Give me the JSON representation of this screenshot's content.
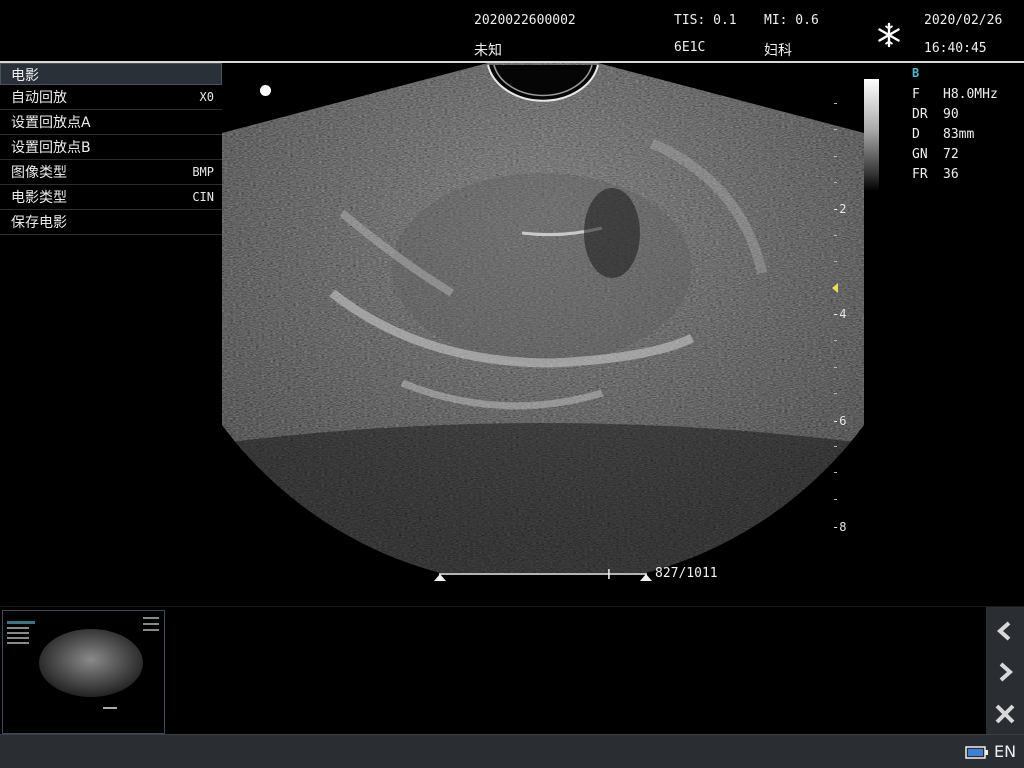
{
  "header": {
    "patient_id": "2020022600002",
    "patient_name": "未知",
    "tis": "TIS: 0.1",
    "mi": "MI: 0.6",
    "probe": "6E1C",
    "exam": "妇科",
    "date": "2020/02/26",
    "time": "16:40:45",
    "freeze_icon": "snowflake-icon"
  },
  "cine_menu": {
    "title": "电影",
    "items": [
      {
        "label": "自动回放",
        "value": "X0"
      },
      {
        "label": "设置回放点A",
        "value": ""
      },
      {
        "label": "设置回放点B",
        "value": ""
      },
      {
        "label": "图像类型",
        "value": "BMP"
      },
      {
        "label": "电影类型",
        "value": "CIN"
      },
      {
        "label": "保存电影",
        "value": ""
      }
    ]
  },
  "params": {
    "mode": "B",
    "rows": [
      {
        "key": "F",
        "value": "H8.0MHz"
      },
      {
        "key": "DR",
        "value": "90"
      },
      {
        "key": "D",
        "value": "83mm"
      },
      {
        "key": "GN",
        "value": "72"
      },
      {
        "key": "FR",
        "value": "36"
      }
    ]
  },
  "depth_scale": {
    "labels": [
      "-2",
      "-4",
      "-6",
      "-8"
    ]
  },
  "cine": {
    "counter": "827/1011",
    "position_fraction": 0.82
  },
  "nav": {
    "prev_icon": "chevron-left-icon",
    "next_icon": "chevron-right-icon",
    "delete_icon": "close-icon"
  },
  "status": {
    "language": "EN",
    "battery_icon": "battery-icon"
  }
}
